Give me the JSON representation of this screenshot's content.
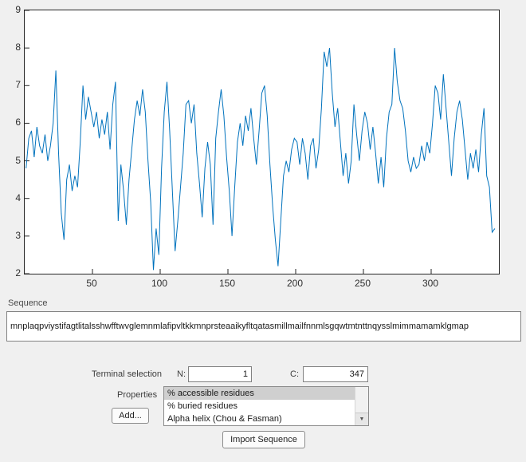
{
  "chart_data": {
    "type": "line",
    "title": "",
    "xlabel": "",
    "ylabel": "",
    "xlim": [
      0,
      350
    ],
    "ylim": [
      2,
      9
    ],
    "xticks": [
      50,
      100,
      150,
      200,
      250,
      300
    ],
    "yticks": [
      2,
      3,
      4,
      5,
      6,
      7,
      8,
      9
    ],
    "grid": false,
    "legend": null,
    "line_color": "#0072BD",
    "x": [
      1,
      3,
      5,
      7,
      9,
      11,
      13,
      15,
      17,
      19,
      21,
      23,
      25,
      27,
      29,
      31,
      33,
      35,
      37,
      39,
      41,
      43,
      45,
      47,
      49,
      51,
      53,
      55,
      57,
      59,
      61,
      63,
      65,
      67,
      69,
      71,
      73,
      75,
      77,
      79,
      81,
      83,
      85,
      87,
      89,
      91,
      93,
      95,
      97,
      99,
      101,
      103,
      105,
      107,
      109,
      111,
      113,
      115,
      117,
      119,
      121,
      123,
      125,
      127,
      129,
      131,
      133,
      135,
      137,
      139,
      141,
      143,
      145,
      147,
      149,
      151,
      153,
      155,
      157,
      159,
      161,
      163,
      165,
      167,
      169,
      171,
      173,
      175,
      177,
      179,
      181,
      183,
      185,
      187,
      189,
      191,
      193,
      195,
      197,
      199,
      201,
      203,
      205,
      207,
      209,
      211,
      213,
      215,
      217,
      219,
      221,
      223,
      225,
      227,
      229,
      231,
      233,
      235,
      237,
      239,
      241,
      243,
      245,
      247,
      249,
      251,
      253,
      255,
      257,
      259,
      261,
      263,
      265,
      267,
      269,
      271,
      273,
      275,
      277,
      279,
      281,
      283,
      285,
      287,
      289,
      291,
      293,
      295,
      297,
      299,
      301,
      303,
      305,
      307,
      309,
      311,
      313,
      315,
      317,
      319,
      321,
      323,
      325,
      327,
      329,
      331,
      333,
      335,
      337,
      339,
      341,
      343,
      345,
      347
    ],
    "y": [
      4.8,
      5.6,
      5.8,
      5.1,
      5.9,
      5.4,
      5.2,
      5.7,
      5.0,
      5.4,
      6.0,
      7.4,
      5.2,
      3.6,
      2.9,
      4.5,
      4.9,
      4.2,
      4.6,
      4.3,
      5.5,
      7.0,
      6.1,
      6.7,
      6.3,
      5.9,
      6.3,
      5.6,
      6.1,
      5.7,
      6.3,
      5.3,
      6.5,
      7.1,
      3.4,
      4.9,
      4.2,
      3.3,
      4.5,
      5.3,
      6.1,
      6.6,
      6.2,
      6.9,
      6.3,
      5.0,
      3.9,
      2.1,
      3.2,
      2.5,
      4.8,
      6.3,
      7.1,
      5.8,
      4.2,
      2.6,
      3.4,
      4.3,
      5.2,
      6.5,
      6.6,
      6.0,
      6.5,
      5.2,
      4.4,
      3.5,
      4.8,
      5.5,
      4.9,
      3.3,
      5.6,
      6.3,
      6.9,
      6.2,
      5.1,
      4.2,
      3.0,
      4.3,
      5.5,
      6.0,
      5.4,
      6.2,
      5.8,
      6.4,
      5.6,
      4.9,
      5.8,
      6.8,
      7.0,
      6.2,
      4.9,
      3.8,
      2.9,
      2.2,
      3.4,
      4.6,
      5.0,
      4.7,
      5.3,
      5.6,
      5.5,
      4.9,
      5.6,
      5.2,
      4.5,
      5.4,
      5.6,
      4.8,
      5.3,
      6.4,
      7.9,
      7.5,
      8.0,
      6.8,
      5.9,
      6.4,
      5.5,
      4.6,
      5.2,
      4.4,
      5.0,
      6.5,
      5.7,
      5.0,
      5.8,
      6.3,
      6.0,
      5.3,
      5.9,
      5.2,
      4.4,
      5.1,
      4.3,
      5.6,
      6.3,
      6.5,
      8.0,
      7.1,
      6.6,
      6.4,
      5.8,
      5.0,
      4.7,
      5.1,
      4.8,
      4.9,
      5.4,
      5.0,
      5.5,
      5.2,
      6.0,
      7.0,
      6.8,
      6.1,
      7.3,
      6.4,
      5.5,
      4.6,
      5.6,
      6.3,
      6.6,
      6.1,
      5.3,
      4.5,
      5.2,
      4.8,
      5.3,
      4.7,
      5.7,
      6.4,
      4.6,
      4.3,
      3.1,
      3.2
    ]
  },
  "sequence": {
    "label": "Sequence",
    "value": "mnplaqpviystifagtlitalsshwfftwvglemnmlafipvltkkmnprsteaaikyfltqatasmillmailfnnmlsgqwtmtnttnqysslmimmamamklgmap"
  },
  "terminal": {
    "label": "Terminal selection",
    "n_label": "N:",
    "n_value": "1",
    "c_label": "C:",
    "c_value": "347"
  },
  "properties": {
    "label": "Properties",
    "add_button": "Add...",
    "options": [
      "% accessible residues",
      "% buried residues",
      "Alpha helix (Chou & Fasman)"
    ],
    "selected_index": 0
  },
  "import_button": "Import Sequence",
  "icons": {
    "down_arrow": "▼"
  },
  "colors": {
    "window_bg": "#f0f0f0",
    "plot_line": "#0072BD",
    "list_selection": "#cfcfcf"
  }
}
